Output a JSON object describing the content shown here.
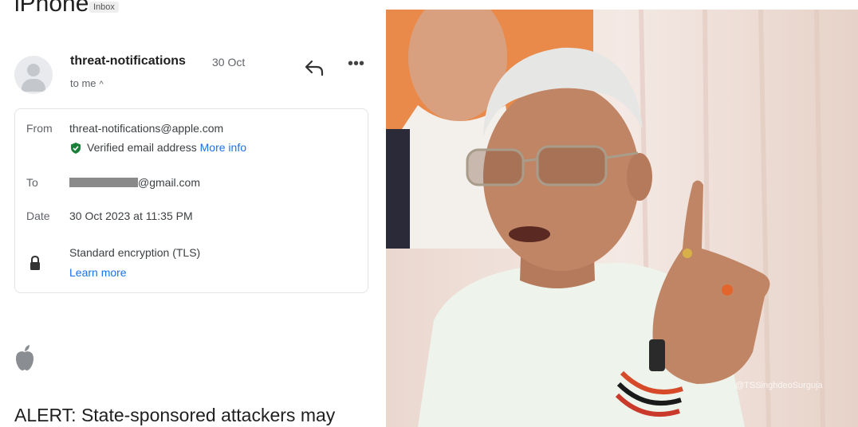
{
  "email": {
    "subject": "iPhone",
    "folder_tag": "Inbox",
    "sender_name": "threat-notifications",
    "date_short": "30 Oct",
    "recipient_summary": "to me",
    "details": {
      "from_label": "From",
      "from_value": "threat-notifications@apple.com",
      "verified_text": "Verified email address",
      "more_info_link": "More info",
      "to_label": "To",
      "to_value": "@gmail.com",
      "date_label": "Date",
      "date_value": "30 Oct 2023 at 11:35 PM",
      "encryption_text": "Standard encryption (TLS)",
      "learn_more_link": "Learn more"
    },
    "alert_text": "ALERT: State-sponsored attackers may"
  },
  "photo": {
    "watermark": "@TSSinghdeoSurguja"
  },
  "icons": [
    "avatar-person-icon",
    "reply-icon",
    "more-options-icon",
    "verified-shield-icon",
    "lock-icon",
    "apple-logo-icon"
  ],
  "colors": {
    "link": "#1a73e8",
    "verified_green": "#188038",
    "text": "#1f1f1f",
    "muted": "#5f6368"
  }
}
